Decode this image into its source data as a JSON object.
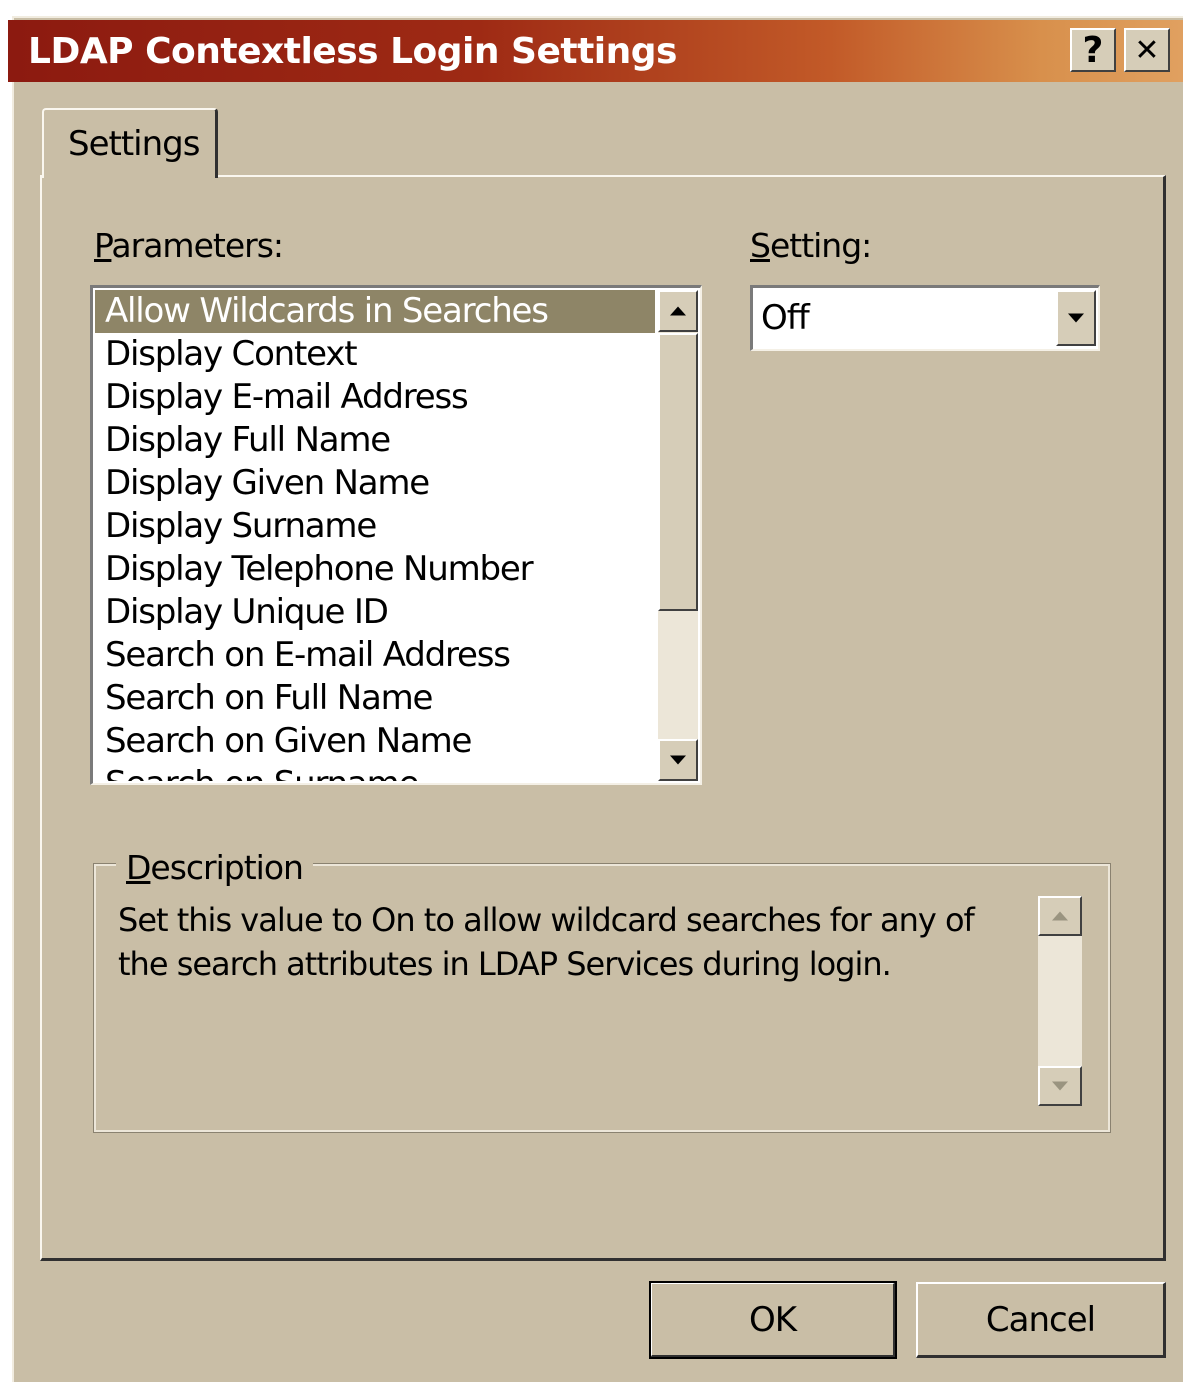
{
  "window": {
    "title": "LDAP Contextless Login Settings",
    "help_label": "?",
    "close_label": "✕"
  },
  "tabs": [
    {
      "label": "Settings",
      "active": true
    }
  ],
  "parameters": {
    "label_mnemonic": "P",
    "label_rest": "arameters:",
    "items": [
      "Allow Wildcards in Searches",
      "Display Context",
      "Display E-mail Address",
      "Display Full Name",
      "Display Given Name",
      "Display Surname",
      "Display Telephone Number",
      "Display Unique ID",
      "Search on E-mail Address",
      "Search on Full Name",
      "Search on Given Name",
      "Search on Surname"
    ],
    "selected_index": 0
  },
  "setting": {
    "label_mnemonic": "S",
    "label_rest": "etting:",
    "value": "Off"
  },
  "description": {
    "title_mnemonic": "D",
    "title_rest": "escription",
    "text": "Set this value to On to allow wildcard searches for any of the search attributes in LDAP Services during login."
  },
  "buttons": {
    "ok": "OK",
    "cancel": "Cancel"
  },
  "colors": {
    "titlebar_start": "#8c1a10",
    "titlebar_end": "#e0a060",
    "dialog_face": "#c9bea6",
    "selection": "#8e8567"
  },
  "icons": [
    "help-icon",
    "close-icon",
    "scroll-up-arrow-icon",
    "scroll-down-arrow-icon",
    "dropdown-arrow-icon"
  ]
}
